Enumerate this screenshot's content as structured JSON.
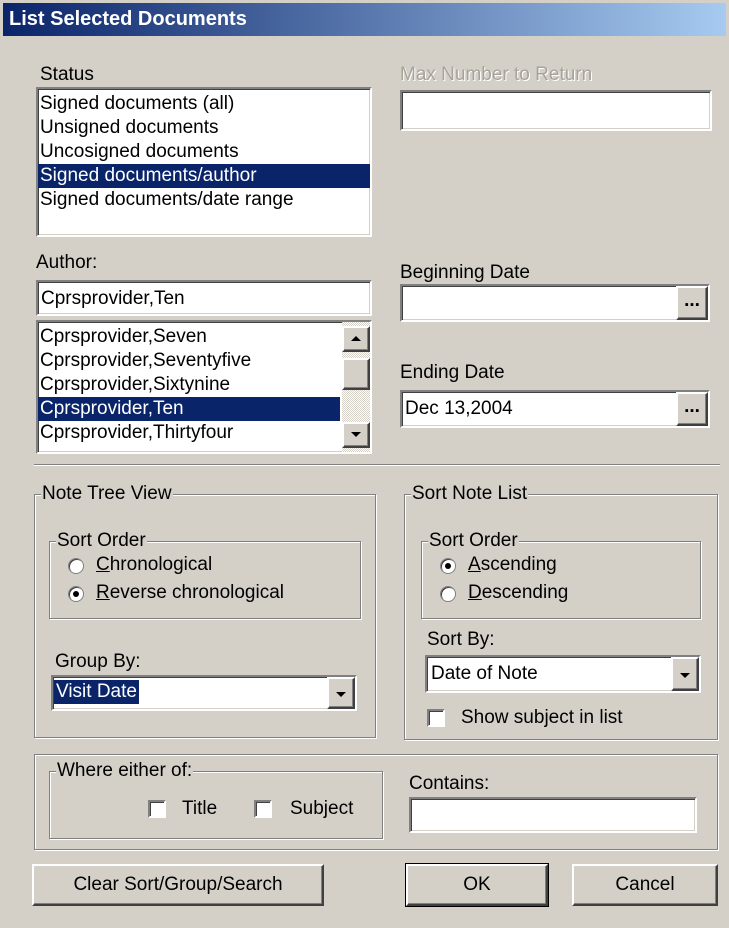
{
  "window": {
    "title": "List Selected Documents"
  },
  "status": {
    "label": "Status",
    "items": [
      "Signed documents (all)",
      "Unsigned documents",
      "Uncosigned documents",
      "Signed documents/author",
      "Signed documents/date range"
    ],
    "selected_index": 3
  },
  "max_number": {
    "label": "Max Number to Return",
    "value": ""
  },
  "author": {
    "label": "Author:",
    "value": "Cprsprovider,Ten",
    "items": [
      "Cprsprovider,Seven",
      "Cprsprovider,Seventyfive",
      "Cprsprovider,Sixtynine",
      "Cprsprovider,Ten",
      "Cprsprovider,Thirtyfour"
    ],
    "selected_index": 3
  },
  "beginning_date": {
    "label": "Beginning Date",
    "value": "",
    "button": "..."
  },
  "ending_date": {
    "label": "Ending Date",
    "value": "Dec 13,2004",
    "button": "..."
  },
  "note_tree_view": {
    "label": "Note Tree View",
    "sort_order_label": "Sort Order",
    "options": [
      {
        "label": "Chronological",
        "accel": "C",
        "rest": "hronological",
        "selected": false
      },
      {
        "label": "Reverse chronological",
        "accel": "R",
        "rest": "everse chronological",
        "selected": true
      }
    ],
    "group_by_label": "Group By:",
    "group_by_value": "Visit Date"
  },
  "sort_note_list": {
    "label": "Sort Note List",
    "sort_order_label": "Sort Order",
    "options": [
      {
        "label": "Ascending",
        "accel": "A",
        "rest": "scending",
        "selected": true
      },
      {
        "label": "Descending",
        "accel": "D",
        "rest": "escending",
        "selected": false
      }
    ],
    "sort_by_label": "Sort By:",
    "sort_by_value": "Date of Note",
    "show_subject_label": "Show subject in list",
    "show_subject_checked": false
  },
  "search": {
    "where_label": "Where either of:",
    "title_label": "Title",
    "title_checked": false,
    "subject_label": "Subject",
    "subject_checked": false,
    "contains_label": "Contains:",
    "contains_value": ""
  },
  "buttons": {
    "clear": "Clear Sort/Group/Search",
    "ok": "OK",
    "cancel": "Cancel"
  },
  "colors": {
    "face": "#d4d0c8",
    "selection": "#0a246a",
    "title_start": "#0a246a",
    "title_end": "#a6caf0"
  }
}
